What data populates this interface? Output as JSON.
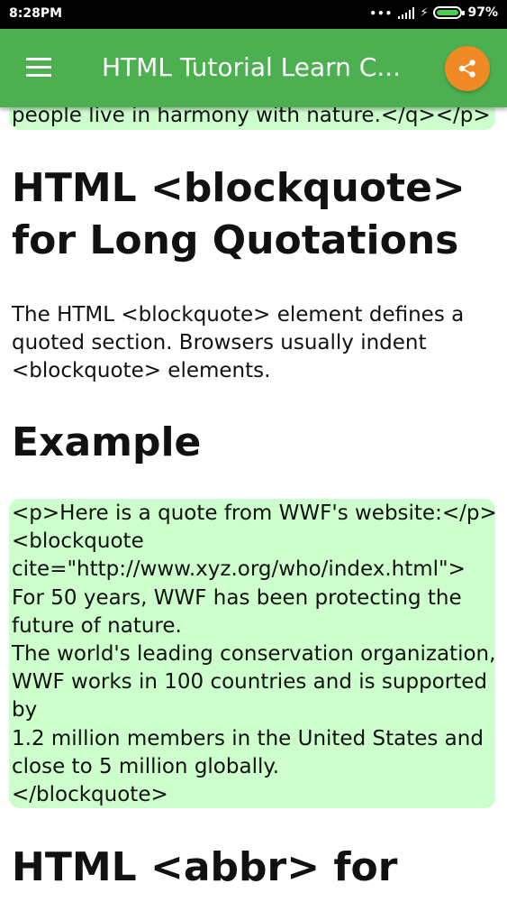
{
  "status_bar": {
    "time": "8:28PM",
    "dots": "•••",
    "battery_text": "97%",
    "battery_level": 0.97,
    "battery_color": "#3fd24a"
  },
  "app_bar": {
    "title": "HTML Tutorial Learn C...",
    "menu_icon": "hamburger-menu-icon",
    "share_icon": "share-icon",
    "bar_color": "#4caf50",
    "share_color": "#f08a24"
  },
  "content": {
    "code_top_text": "people live in harmony with nature.</q></p>",
    "heading_blockquote": "HTML <blockquote> for Long Quotations",
    "paragraph": "The HTML <blockquote> element defines a quoted section. Browsers usually indent <blockquote> elements.",
    "heading_example": "Example",
    "code_example_lines": [
      "<p>Here is a quote from WWF's website:</p>",
      "<blockquote",
      "cite=\"http://www.xyz.org/who/index.html\">",
      "For 50 years, WWF has been protecting the",
      "future of nature.",
      "The world's leading conservation organization,",
      "WWF works in 100 countries and is supported",
      "by",
      "1.2 million members in the United States and",
      "close to 5 million globally.",
      "</blockquote>"
    ],
    "heading_abbr": "HTML <abbr> for",
    "code_bg_color": "#ccffcc"
  }
}
